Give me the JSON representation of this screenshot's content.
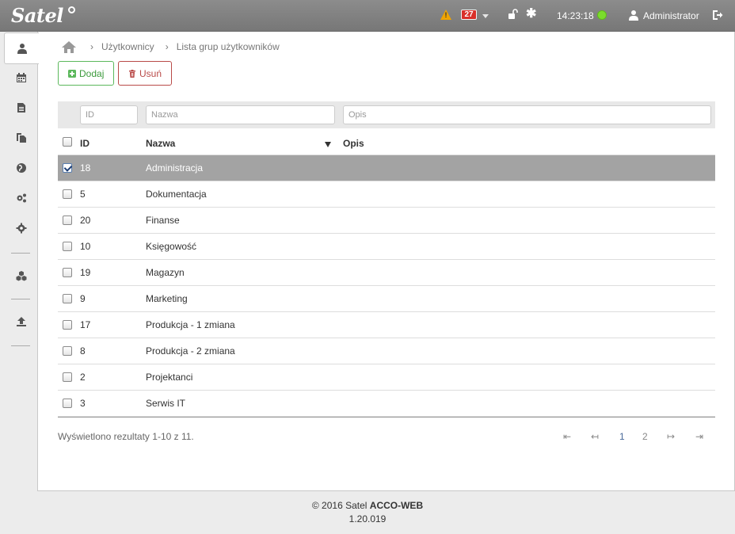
{
  "header": {
    "logo": "Satel",
    "alarm_count": "27",
    "time": "14:23:18",
    "user": "Administrator",
    "status_color": "#7bdc2c"
  },
  "breadcrumb": {
    "items": [
      "Użytkownicy",
      "Lista grup użytkowników"
    ]
  },
  "toolbar": {
    "add_label": "Dodaj",
    "delete_label": "Usuń"
  },
  "filters": {
    "id_placeholder": "ID",
    "name_placeholder": "Nazwa",
    "desc_placeholder": "Opis"
  },
  "table": {
    "columns": [
      "ID",
      "Nazwa",
      "Opis"
    ],
    "rows": [
      {
        "id": "18",
        "name": "Administracja",
        "desc": "",
        "selected": true
      },
      {
        "id": "5",
        "name": "Dokumentacja",
        "desc": "",
        "selected": false
      },
      {
        "id": "20",
        "name": "Finanse",
        "desc": "",
        "selected": false
      },
      {
        "id": "10",
        "name": "Księgowość",
        "desc": "",
        "selected": false
      },
      {
        "id": "19",
        "name": "Magazyn",
        "desc": "",
        "selected": false
      },
      {
        "id": "9",
        "name": "Marketing",
        "desc": "",
        "selected": false
      },
      {
        "id": "17",
        "name": "Produkcja - 1 zmiana",
        "desc": "",
        "selected": false
      },
      {
        "id": "8",
        "name": "Produkcja - 2 zmiana",
        "desc": "",
        "selected": false
      },
      {
        "id": "2",
        "name": "Projektanci",
        "desc": "",
        "selected": false
      },
      {
        "id": "3",
        "name": "Serwis IT",
        "desc": "",
        "selected": false
      }
    ]
  },
  "pagination": {
    "summary": "Wyświetlono rezultaty 1-10 z 11.",
    "first": "⇤",
    "prev": "↤",
    "pages": [
      "1",
      "2"
    ],
    "next": "↦",
    "last": "⇥"
  },
  "footer": {
    "copyright": "© 2016 Satel",
    "product": "ACCO-WEB",
    "version": "1.20.019"
  }
}
